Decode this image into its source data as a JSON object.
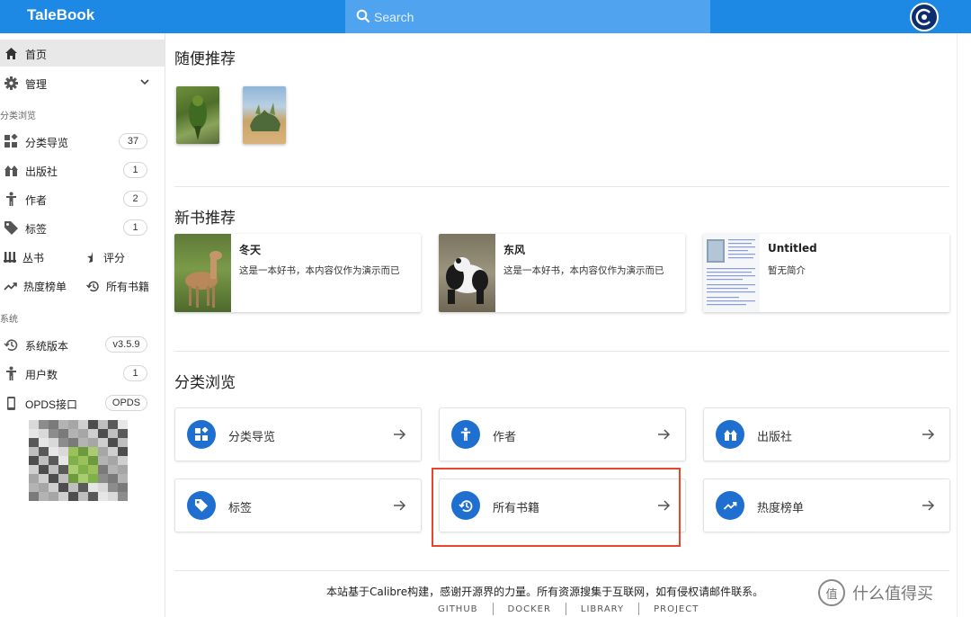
{
  "app": {
    "title": "TaleBook"
  },
  "search": {
    "placeholder": "Search"
  },
  "sidebar": {
    "home": "首页",
    "manage": "管理",
    "browse_heading": "分类浏览",
    "items": [
      {
        "label": "分类导览",
        "count": "37"
      },
      {
        "label": "出版社",
        "count": "1"
      },
      {
        "label": "作者",
        "count": "2"
      },
      {
        "label": "标签",
        "count": "1"
      }
    ],
    "pair1": {
      "left": "丛书",
      "right": "评分"
    },
    "pair2": {
      "left": "热度榜单",
      "right": "所有书籍"
    },
    "system_heading": "系统",
    "system": [
      {
        "label": "系统版本",
        "chip": "v3.5.9"
      },
      {
        "label": "用户数",
        "chip": "1"
      },
      {
        "label": "OPDS接口",
        "chip": "OPDS"
      }
    ]
  },
  "main": {
    "random_title": "随便推荐",
    "new_title": "新书推荐",
    "new_books": [
      {
        "title": "冬天",
        "desc": "这是一本好书，本内容仅作为演示而已"
      },
      {
        "title": "东风",
        "desc": "这是一本好书，本内容仅作为演示而已"
      },
      {
        "title": "Untitled",
        "desc": "暂无简介"
      }
    ],
    "browse_title": "分类浏览",
    "categories": [
      {
        "label": "分类导览"
      },
      {
        "label": "作者"
      },
      {
        "label": "出版社"
      },
      {
        "label": "标签"
      },
      {
        "label": "所有书籍"
      },
      {
        "label": "热度榜单"
      }
    ]
  },
  "footer": {
    "text": "本站基于Calibre构建，感谢开源界的力量。所有资源搜集于互联网，如有侵权请邮件联系。",
    "links": [
      "GITHUB",
      "DOCKER",
      "LIBRARY",
      "PROJECT"
    ]
  },
  "watermark": {
    "text": "什么值得买",
    "logo": "值"
  },
  "colors": {
    "primary": "#1e88e5",
    "icon_circle": "#1f6fd0",
    "highlight": "#e8452c"
  }
}
